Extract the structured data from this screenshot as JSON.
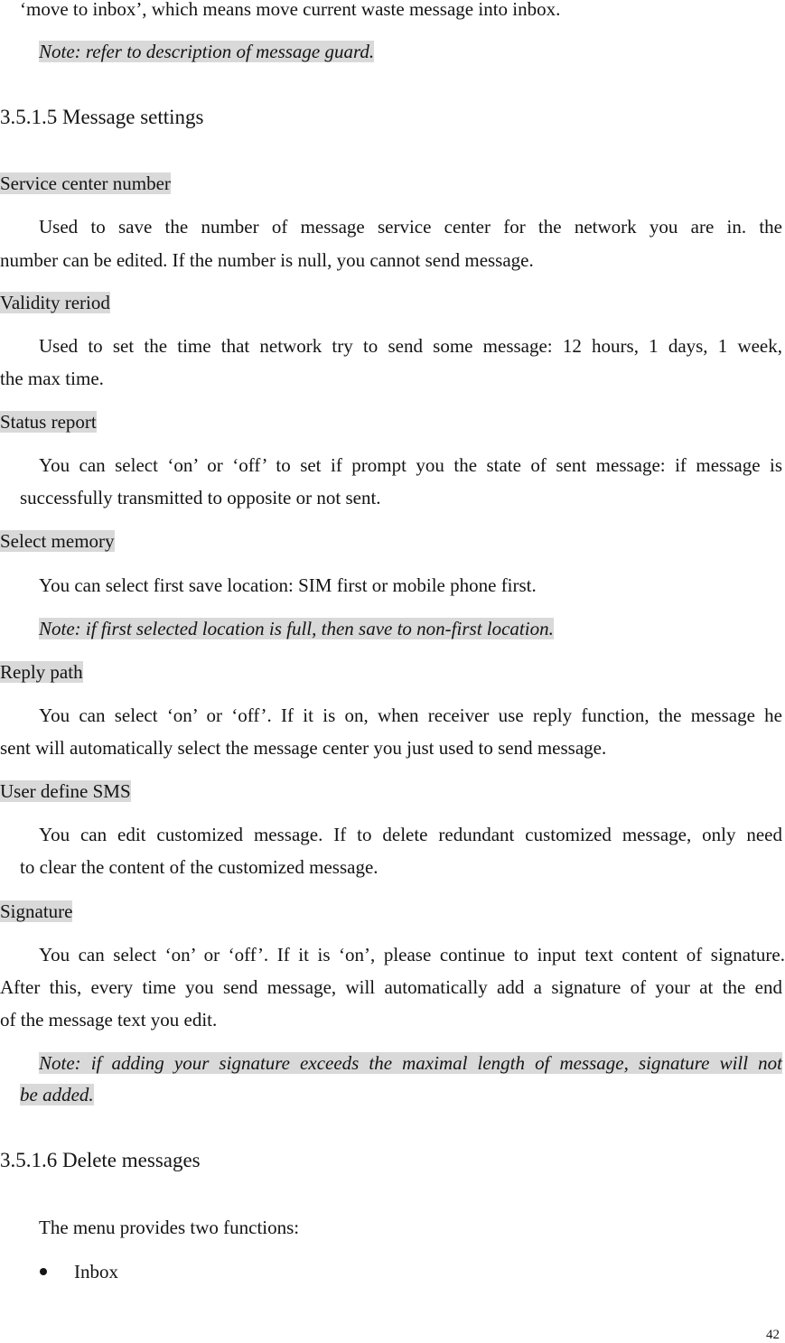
{
  "page": {
    "intro_line": "‘move to inbox’, which means move current waste message into inbox.",
    "intro_note": "Note: refer to description of message guard.",
    "section_355": {
      "heading": "3.5.1.5 Message settings",
      "items": [
        {
          "term": "Service center number",
          "lines": [
            "Used to save the number of message service center for the network you are in. the",
            "number can be edited. If the number is null, you cannot send message."
          ]
        },
        {
          "term": "Validity reriod",
          "lines": [
            "Used to set the time that network try to send some message: 12 hours, 1 days, 1 week,",
            "the max time."
          ]
        },
        {
          "term": "Status report",
          "lines": [
            "You can select ‘on’ or ‘off’ to set if prompt you the state of sent message: if message is",
            "successfully transmitted to opposite or not sent."
          ]
        },
        {
          "term": "Select memory",
          "lines": [
            "You can select first save location: SIM first or mobile phone first."
          ],
          "note": "Note: if first selected location is full, then save to non-first location."
        },
        {
          "term": "Reply path",
          "lines": [
            "You can select ‘on’ or ‘off’. If it is on, when receiver use reply function, the message he",
            "sent will automatically select the message center you just used to send message."
          ]
        },
        {
          "term": "User define SMS",
          "lines": [
            "You can edit customized message. If to delete redundant customized message, only need",
            "to clear the content of the customized message."
          ]
        },
        {
          "term": "Signature",
          "lines": [
            "You can select ‘on’ or ‘off’. If it is ‘on’, please continue to input text content of signature.",
            "After this, every time you send message, will automatically add a signature of your at the end",
            "of the message text you edit."
          ],
          "note_lines": [
            "Note: if adding your signature exceeds the maximal length of message, signature will not",
            "be added."
          ]
        }
      ]
    },
    "section_356": {
      "heading": "3.5.1.6 Delete messages",
      "intro": "The menu provides two functions:",
      "bullets": [
        "Inbox"
      ]
    },
    "page_number": "42"
  }
}
